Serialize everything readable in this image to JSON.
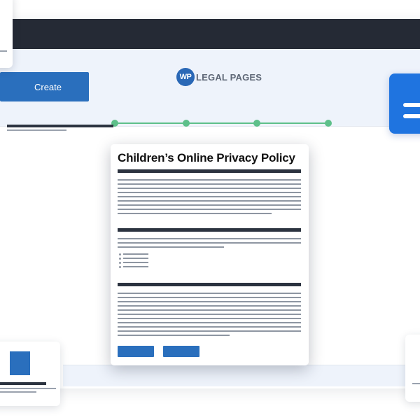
{
  "app": {
    "logo_badge": "WP",
    "logo_text": "LEGAL PAGES",
    "create_label": "Create",
    "stepper_steps": 4
  },
  "policy": {
    "title": "Children’s Online Privacy Policy"
  },
  "colors": {
    "topbar": "#252a35",
    "header_bg": "#eef3fb",
    "accent_blue": "#2a6fbd",
    "step_green": "#5ec08a",
    "doc_icon_blue": "#1f74e0"
  },
  "icons": {
    "doc_app": "document-lines-icon",
    "logo": "wp-legal-pages-logo"
  }
}
